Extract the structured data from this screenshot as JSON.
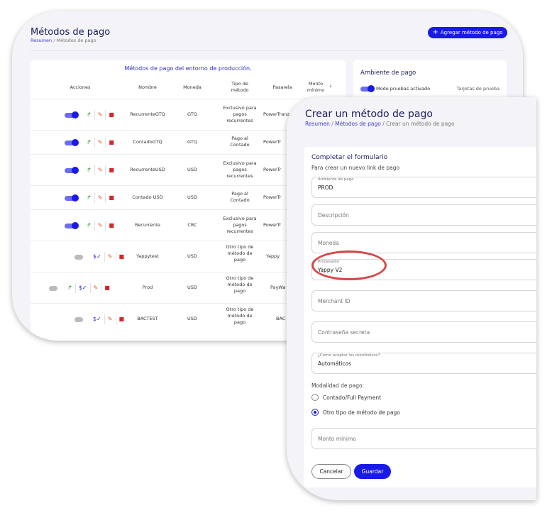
{
  "back": {
    "title": "Métodos de pago",
    "breadcrumb": [
      "Resumen",
      "/",
      "Métodos de pago"
    ],
    "add_button": "Agregar método de pago",
    "table_title": "Métodos de pago del entorno de producción.",
    "columns": [
      "Acciones",
      "Nombre",
      "Moneda",
      "Tipo de método",
      "Pasarela",
      "Monto mínimo"
    ],
    "rows": [
      {
        "nombre": "RecurrenteGTQ",
        "moneda": "GTQ",
        "tipo": "Exclusivo para pagos recurrentes",
        "pasarela": "PowerTranz",
        "enabled": true,
        "actions": [
          "toggle",
          "split",
          "edit",
          "delete"
        ]
      },
      {
        "nombre": "ContadoGTQ",
        "moneda": "GTQ",
        "tipo": "Pago al Contado",
        "pasarela": "PowerTr",
        "enabled": true,
        "actions": [
          "toggle",
          "split",
          "edit",
          "delete"
        ]
      },
      {
        "nombre": "RecurrenteUSD",
        "moneda": "USD",
        "tipo": "Exclusivo para pagos recurrentes",
        "pasarela": "PowerTr",
        "enabled": true,
        "actions": [
          "toggle",
          "split",
          "edit",
          "delete"
        ]
      },
      {
        "nombre": "Contado USD",
        "moneda": "USD",
        "tipo": "Pago al Contado",
        "pasarela": "PowerTr",
        "enabled": true,
        "actions": [
          "toggle",
          "split",
          "edit",
          "delete"
        ]
      },
      {
        "nombre": "Recurrente",
        "moneda": "CRC",
        "tipo": "Exclusivo para pagos recurrentes",
        "pasarela": "PowerTr",
        "enabled": true,
        "actions": [
          "toggle",
          "split",
          "edit",
          "delete"
        ]
      },
      {
        "nombre": "Yappytest",
        "moneda": "USD",
        "tipo": "Otro tipo de método de pago",
        "pasarela": "Yappy",
        "enabled": false,
        "actions": [
          "toggle",
          "check",
          "edit",
          "delete"
        ]
      },
      {
        "nombre": "Prod",
        "moneda": "USD",
        "tipo": "Otro tipo de método de pago",
        "pasarela": "PayWa",
        "enabled": false,
        "actions": [
          "toggle",
          "split",
          "check",
          "edit",
          "delete"
        ]
      },
      {
        "nombre": "BACTEST",
        "moneda": "USD",
        "tipo": "Otro tipo de método de pago",
        "pasarela": "BAC",
        "enabled": false,
        "actions": [
          "toggle",
          "check",
          "edit",
          "delete"
        ]
      }
    ],
    "env_title": "Ambiente de pago",
    "env_mode": "Modo pruebas activado",
    "env_cards": "Tarjetas de prueba"
  },
  "front": {
    "title": "Crear un método de pago",
    "breadcrumb": [
      "Resumen",
      "/",
      "Métodos de pago",
      "/",
      "Crear un método de pago"
    ],
    "form_title": "Completar el formulario",
    "form_subtitle": "Para crear un nuevo link de pago",
    "fields": [
      {
        "label": "Ambiente de pago",
        "value": "PROD",
        "placeholder": ""
      },
      {
        "label": "",
        "value": "",
        "placeholder": "Descripción"
      },
      {
        "label": "",
        "value": "",
        "placeholder": "Moneda"
      },
      {
        "label": "Procesador",
        "value": "Yappy V2",
        "placeholder": ""
      },
      {
        "label": "",
        "value": "",
        "placeholder": "Merchant ID"
      },
      {
        "label": "",
        "value": "",
        "placeholder": "Contraseña secreta"
      },
      {
        "label": "¿Como aceptar los reembolsos?",
        "value": "Automáticos",
        "placeholder": ""
      },
      {
        "label": "",
        "value": "",
        "placeholder": "Monto mínimo"
      }
    ],
    "modalidad_label": "Modalidad de pago:",
    "radio_options": [
      "Contado/Full Payment",
      "Otro tipo de método de pago"
    ],
    "selected_option": "Otro tipo de método de pago",
    "cancel_button": "Cancelar",
    "save_button": "Guardar"
  },
  "colors": {
    "accent": "#1a1ae6",
    "highlight": "#d64848",
    "delete": "#d8262a",
    "edit": "#e0562a",
    "split": "#27a327"
  }
}
